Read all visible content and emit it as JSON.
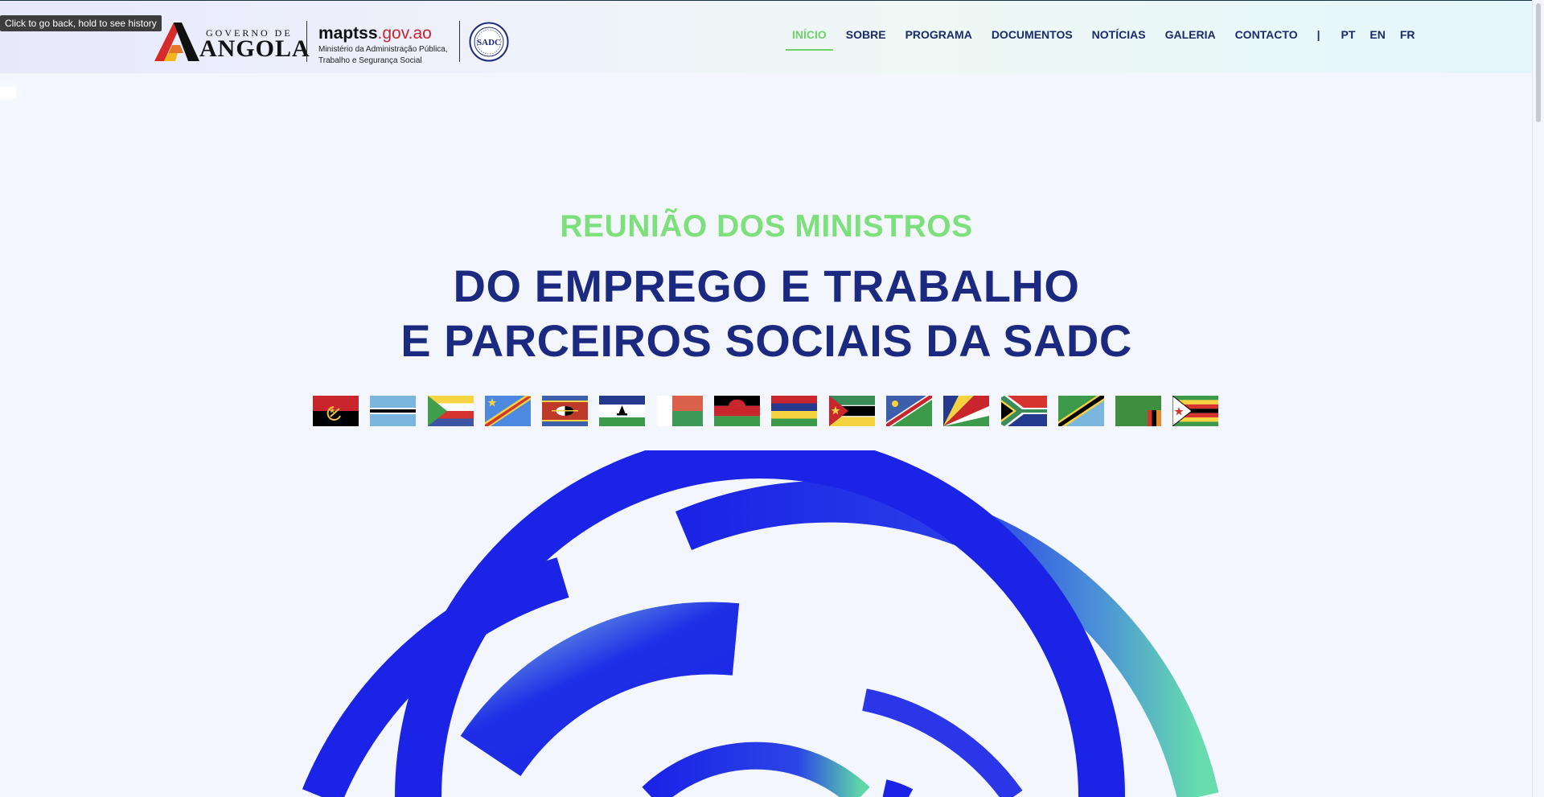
{
  "browser": {
    "tooltip": "Click to go back, hold to see history"
  },
  "header": {
    "angola_logo_top": "GOVERNO DE",
    "angola_logo_main": "ANGOLA",
    "ministry_name": "maptss",
    "ministry_domain": ".gov.ao",
    "ministry_line1": "Ministério da Administração Pública,",
    "ministry_line2": "Trabalho e Segurança Social",
    "seal_text": "SADC"
  },
  "nav": {
    "items": [
      {
        "label": "INÍCIO",
        "active": true
      },
      {
        "label": "SOBRE",
        "active": false
      },
      {
        "label": "PROGRAMA",
        "active": false
      },
      {
        "label": "DOCUMENTOS",
        "active": false
      },
      {
        "label": "NOTÍCIAS",
        "active": false
      },
      {
        "label": "GALERIA",
        "active": false
      },
      {
        "label": "CONTACTO",
        "active": false
      }
    ],
    "separator": "|",
    "languages": [
      "PT",
      "EN",
      "FR"
    ]
  },
  "hero": {
    "kicker": "REUNIÃO DOS MINISTROS",
    "title_line1": "DO EMPREGO E TRABALHO",
    "title_line2": "E PARCEIROS SOCIAIS DA SADC"
  },
  "flags": [
    "angola-flag",
    "botswana-flag",
    "comoros-flag",
    "dr-congo-flag",
    "eswatini-flag",
    "lesotho-flag",
    "madagascar-flag",
    "malawi-flag",
    "mauritius-flag",
    "mozambique-flag",
    "namibia-flag",
    "seychelles-flag",
    "south-africa-flag",
    "tanzania-flag",
    "zambia-flag",
    "zimbabwe-flag"
  ],
  "colors": {
    "accent_green": "#7ee07d",
    "navy": "#1b2a80",
    "arc_blue": "#1a23e6",
    "arc_teal": "#5fd6a8"
  }
}
